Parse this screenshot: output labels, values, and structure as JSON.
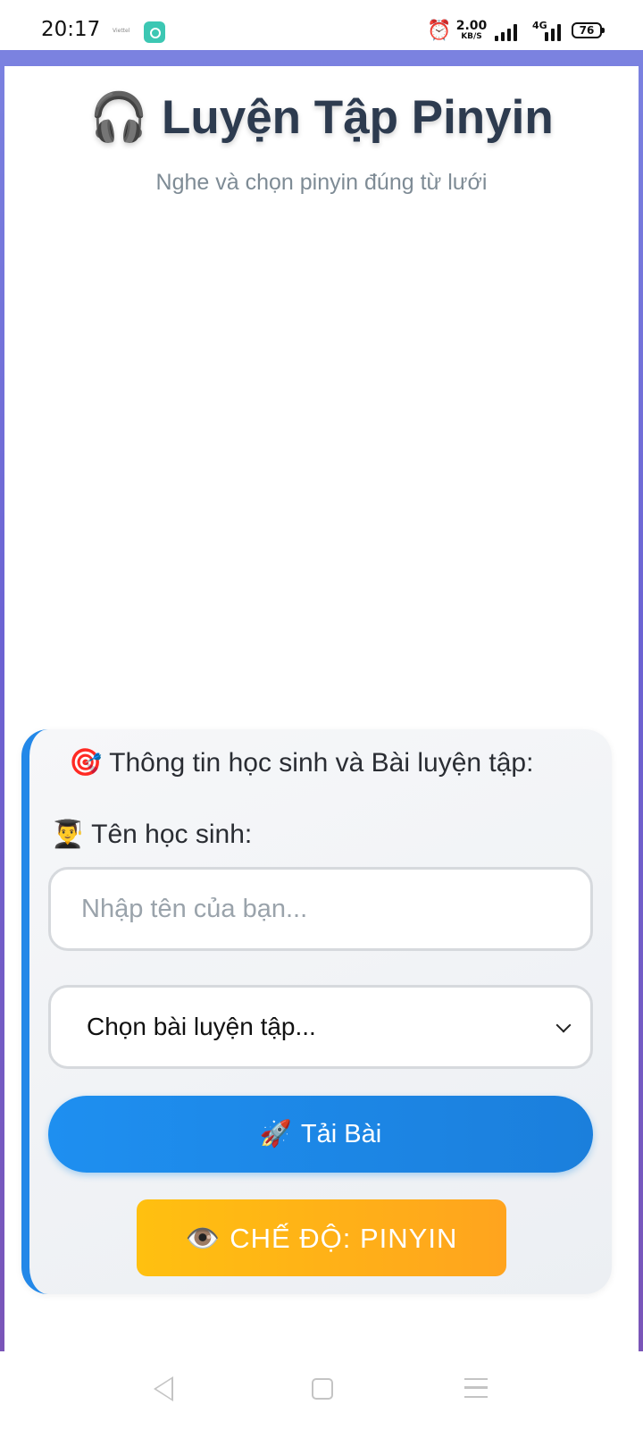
{
  "status_bar": {
    "time": "20:17",
    "carrier": "Viettel",
    "speed_value": "2.00",
    "speed_unit": "KB/S",
    "network": "4G",
    "battery": "76",
    "icons": [
      "alarm-icon",
      "signal-icon",
      "battery-icon"
    ]
  },
  "header": {
    "title_icon": "🎧",
    "title": "Luyện Tập Pinyin",
    "subtitle": "Nghe và chọn pinyin đúng từ lưới"
  },
  "form": {
    "heading_icon": "🎯",
    "heading": "Thông tin học sinh và Bài luyện tập:",
    "name_label_icon": "👨‍🎓",
    "name_label": "Tên học sinh:",
    "name_placeholder": "Nhập tên của bạn...",
    "name_value": "",
    "lesson_select_value": "Chọn bài luyện tập...",
    "load_button_icon": "🚀",
    "load_button_label": "Tải Bài",
    "mode_button_icon": "👁️",
    "mode_button_label": "CHẾ ĐỘ: PINYIN"
  },
  "colors": {
    "frame_gradient_top": "#7b82e0",
    "frame_gradient_bottom": "#7a55b8",
    "accent_blue": "#1e8ff0",
    "accent_orange": "#ffa41e",
    "title_text": "#2d3b4f"
  },
  "nav_bar": {
    "icons": [
      "back-icon",
      "home-icon",
      "menu-icon"
    ]
  }
}
